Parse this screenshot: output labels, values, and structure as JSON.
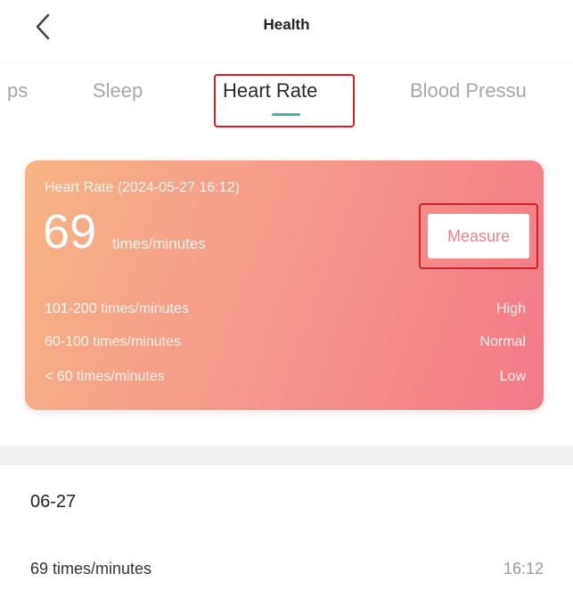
{
  "header": {
    "title": "Health",
    "back_icon": "chevron-left-icon"
  },
  "tabs": [
    {
      "label": "ps",
      "active": false
    },
    {
      "label": "Sleep",
      "active": false
    },
    {
      "label": "Heart Rate",
      "active": true
    },
    {
      "label": "Blood Pressu",
      "active": false
    }
  ],
  "card": {
    "title": "Heart Rate  (2024-05-27 16:12)",
    "value": "69",
    "unit": "times/minutes",
    "measure_label": "Measure",
    "ranges": [
      {
        "range": "101-200 times/minutes",
        "level": "High"
      },
      {
        "range": "60-100 times/minutes",
        "level": "Normal"
      },
      {
        "range": "< 60 times/minutes",
        "level": "Low"
      }
    ]
  },
  "history": {
    "date": "06-27",
    "records": [
      {
        "value": "69 times/minutes",
        "time": "16:12"
      }
    ]
  },
  "colors": {
    "accent_underline": "#3bb9a4",
    "highlight_red": "#d6202b",
    "card_gradient_start": "#f8b583",
    "card_gradient_end": "#f37a8a"
  }
}
